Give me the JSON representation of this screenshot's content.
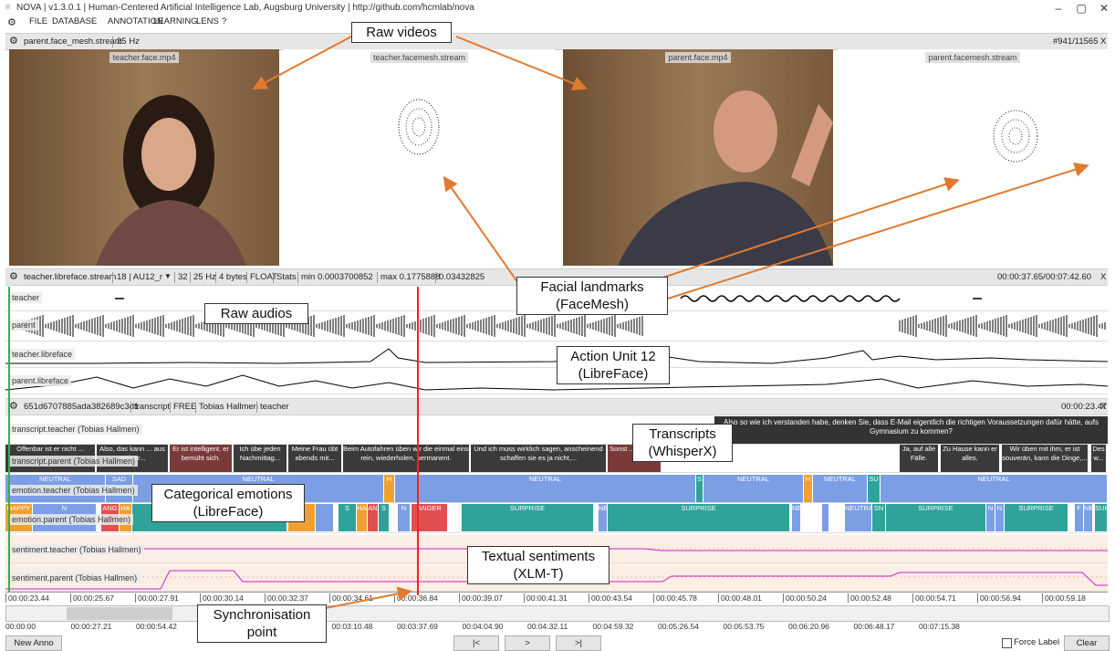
{
  "window": {
    "title": "NOVA | v1.3.0.1 | Human-Centered Artificial Intelligence Lab, Augsburg University | http://github.com/hcmlab/nova"
  },
  "menu": [
    "FILE",
    "DATABASE",
    "ANNOTATION",
    "LEARNING",
    "LENS",
    "?"
  ],
  "video_header": {
    "name": "parent.face_mesh.stream",
    "rate": "25 Hz",
    "frame": "#941/11565",
    "close": "X"
  },
  "videos": [
    {
      "label": "teacher.face.mp4"
    },
    {
      "label": "teacher.facemesh.stream"
    },
    {
      "label": "parent.face.mp4"
    },
    {
      "label": "parent.facemesh.stream"
    }
  ],
  "signal_header": {
    "name": "teacher.libreface.stream",
    "dim": "18 | AU12_r",
    "dropdown": "▼",
    "count": "32",
    "rate": "25 Hz",
    "bytes": "4 bytes",
    "type": "FLOAT",
    "stats": "Stats",
    "min": "min 0.0003700852",
    "max": "max 0.1775888",
    "val": "0.03432825",
    "time": "00:00:37.65/00:07:42.60",
    "close": "X"
  },
  "signal_tracks": [
    "teacher",
    "parent",
    "teacher.libreface",
    "parent.libreface"
  ],
  "anno_header": {
    "id": "651d6707885ada382689c3d1",
    "scheme": "transcript",
    "type": "FREE",
    "annotator": "Tobias Hallmen",
    "role": "teacher",
    "time": "00:00:23.47",
    "close": "X"
  },
  "anno_tracks": {
    "transcript_teacher": "transcript.teacher (Tobias Hallmen)",
    "transcript_parent": "transcript.parent (Tobias Hallmen)",
    "emotion_teacher": "emotion.teacher (Tobias Hallmen)",
    "emotion_parent": "emotion.parent (Tobias Hallmen)",
    "sentiment_teacher": "sentiment.teacher (Tobias Hallmen)",
    "sentiment_parent": "sentiment.parent (Tobias Hallmen)"
  },
  "teacher_transcript_text": "Also so wie ich verstanden habe, denken Sie, dass E-Mail eigentlich die richtigen Voraussetzungen dafür hätte, aufs Gymnasium zu kommen?",
  "parent_transcripts": [
    "Offenbar ist er nicht ...",
    "Also, das kann ... aus meiner...",
    "Er ist intelligent, er bemüht sich.",
    "Ich übe jeden Nachmittag...",
    "Meine Frau übt abends mit...",
    "Beim Autofahren üben wir die einmal eins rein, wiederholen, permanent.",
    "Und ich muss wirklich sagen, anscheinend schaffen sie es ja nicht,...",
    "Sonst ... nicht ...",
    "Ja, auf alle Fälle.",
    "Zu Hause kann er alles.",
    "Wir üben mit ihm, er ist souverän, kann die Dinge,...",
    "Des w..."
  ],
  "emotion_labels": {
    "neutral": "NEUTRAL",
    "sad": "SAD",
    "surprise": "SURPRISE",
    "anger": "ANGER",
    "happy": "HAPPY"
  },
  "timeline_ticks": [
    "00:00:23.44",
    "00:00:25.67",
    "00:00:27.91",
    "00:00:30.14",
    "00:00:32.37",
    "00:00:34.61",
    "00:00:36.84",
    "00:00:39.07",
    "00:00:41.31",
    "00:00:43.54",
    "00:00:45.78",
    "00:00:48.01",
    "00:00:50.24",
    "00:00:52.48",
    "00:00:54.71",
    "00:00:56.94",
    "00:00:59.18"
  ],
  "overview_ticks": [
    "00:00:00",
    "00:00:27.21",
    "00:00:54.42",
    "00:02:16.05",
    "00:02:43.27",
    "00:03:10.48",
    "00:03:37.69",
    "00:04:04.90",
    "00:04:32.11",
    "00:04:59.32",
    "00:05:26.54",
    "00:05:53.75",
    "00:06:20.96",
    "00:06:48.17",
    "00:07:15.38"
  ],
  "controls": {
    "new_anno": "New Anno",
    "prev": "|<",
    "play": ">",
    "next": ">|",
    "force_label": "Force Label",
    "clear": "Clear"
  },
  "callouts": {
    "raw_videos": "Raw videos",
    "facial_landmarks": "Facial landmarks (FaceMesh)",
    "raw_audios": "Raw audios",
    "action_unit": "Action Unit 12 (LibreFace)",
    "transcripts": "Transcripts (WhisperX)",
    "emotions": "Categorical emotions (LibreFace)",
    "sentiments": "Textual sentiments (XLM-T)",
    "sync": "Synchronisation point"
  },
  "colors": {
    "neutral": "#7b9ee4",
    "surprise": "#2fa39a",
    "anger": "#e05050",
    "happy": "#f0a030",
    "playhead": "#ff2020",
    "callout_arrow": "#e07a30",
    "sentiment_line": "#d020d0"
  }
}
